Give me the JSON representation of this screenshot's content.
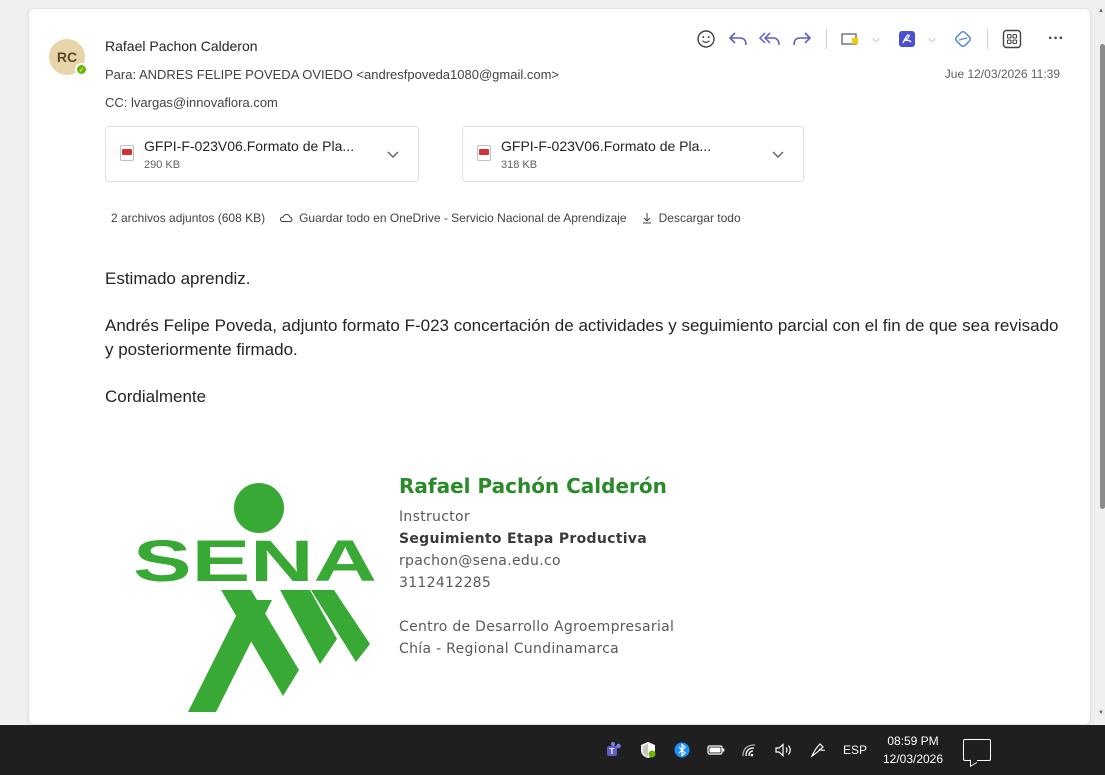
{
  "email": {
    "avatar_initials": "RC",
    "sender": "Rafael Pachon Calderon",
    "to_label": "Para:",
    "to_value": "ANDRES FELIPE POVEDA OVIEDO <andresfpoveda1080@gmail.com>",
    "cc_label": "CC:",
    "cc_value": "lvargas@innovaflora.com",
    "date": "Jue 12/03/2026 11:39"
  },
  "toolbar": {
    "icons": [
      "emoji-icon",
      "reply-icon",
      "reply-all-icon",
      "forward-icon",
      "immersive-reader-icon",
      "adobe-pdf-icon",
      "copilot-icon",
      "apps-icon",
      "more-icon"
    ]
  },
  "attachments": [
    {
      "name": "GFPI-F-023V06.Formato de Pla...",
      "size": "290 KB"
    },
    {
      "name": "GFPI-F-023V06.Formato de Pla...",
      "size": "318 KB"
    }
  ],
  "attachments_summary": {
    "count": "2 archivos adjuntos (608 KB)",
    "save_onedrive": "Guardar todo en OneDrive - Servicio Nacional de Aprendizaje",
    "download_all": "Descargar todo"
  },
  "body": {
    "greeting": "Estimado aprendiz.",
    "paragraph": "Andrés Felipe Poveda, adjunto formato F-023 concertación de actividades y seguimiento parcial con el fin de que sea revisado y posteriormente firmado.",
    "closing": "Cordialmente"
  },
  "signature": {
    "logo_text": "SENA",
    "name": "Rafael Pachón Calderón",
    "role": "Instructor",
    "area": "Seguimiento Etapa Productiva",
    "email": "rpachon@sena.edu.co",
    "phone": "3112412285",
    "center": "Centro de Desarrollo Agroempresarial",
    "region": "Chía - Regional Cundinamarca"
  },
  "colors": {
    "accent": "#5b5fc7",
    "sena_green": "#39a935",
    "signature_name": "#2a8a2a"
  },
  "taskbar": {
    "language": "ESP",
    "time": "08:59 PM",
    "date": "12/03/2026"
  }
}
